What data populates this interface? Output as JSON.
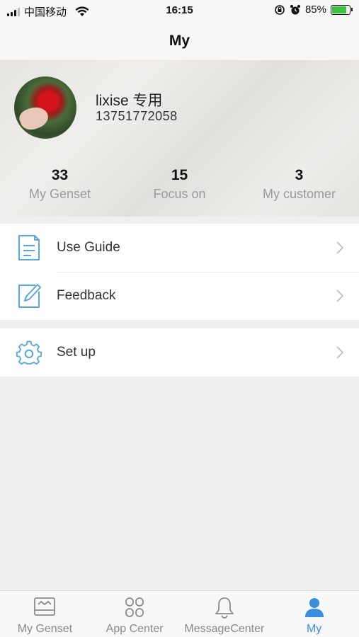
{
  "status_bar": {
    "carrier": "中国移动",
    "time": "16:15",
    "battery_percent": "85%",
    "battery_level": 0.85,
    "battery_color": "#3cc43c"
  },
  "nav": {
    "title": "My"
  },
  "profile": {
    "name": "lixise 专用",
    "phone": "13751772058",
    "stats": [
      {
        "value": "33",
        "label": "My Genset"
      },
      {
        "value": "15",
        "label": "Focus on"
      },
      {
        "value": "3",
        "label": "My customer"
      }
    ]
  },
  "menu": {
    "group1": [
      {
        "label": "Use Guide",
        "icon": "document-icon"
      },
      {
        "label": "Feedback",
        "icon": "edit-icon"
      }
    ],
    "group2": [
      {
        "label": "Set up",
        "icon": "gear-icon"
      }
    ]
  },
  "tab_bar": {
    "tabs": [
      {
        "label": "My Genset",
        "icon": "genset-icon",
        "active": false
      },
      {
        "label": "App Center",
        "icon": "app-center-icon",
        "active": false
      },
      {
        "label": "MessageCenter",
        "icon": "bell-icon",
        "active": false
      },
      {
        "label": "My",
        "icon": "user-icon",
        "active": true
      }
    ],
    "active_color": "#3a8fdc",
    "inactive_color": "#888888"
  },
  "colors": {
    "accent": "#3a8fdc",
    "icon_blue": "#5aa8d8"
  }
}
